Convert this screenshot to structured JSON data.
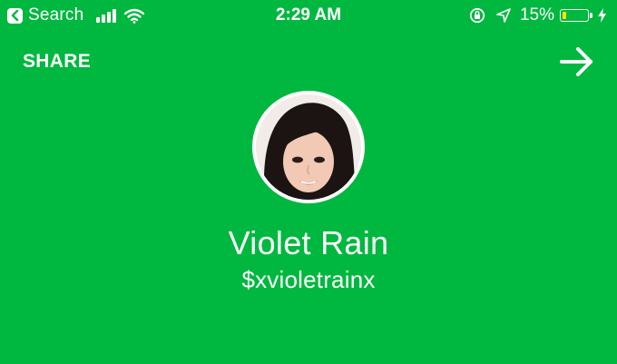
{
  "status_bar": {
    "back_app_label": "Search",
    "time": "2:29 AM",
    "battery_percent_text": "15%",
    "battery_level": 0.15,
    "signal_bars": 4,
    "icons": [
      "back-chevron-icon",
      "cellular-signal-icon",
      "wifi-icon",
      "orientation-lock-icon",
      "location-arrow-icon",
      "battery-icon",
      "charging-bolt-icon"
    ]
  },
  "header": {
    "share_label": "SHARE",
    "next_icon": "arrow-right-icon"
  },
  "profile": {
    "name": "Violet Rain",
    "cashtag": "$xvioletrainx",
    "avatar_icon": "profile-photo"
  },
  "colors": {
    "background": "#00b83f",
    "text": "#ffffff",
    "battery_low": "#ffe600"
  }
}
